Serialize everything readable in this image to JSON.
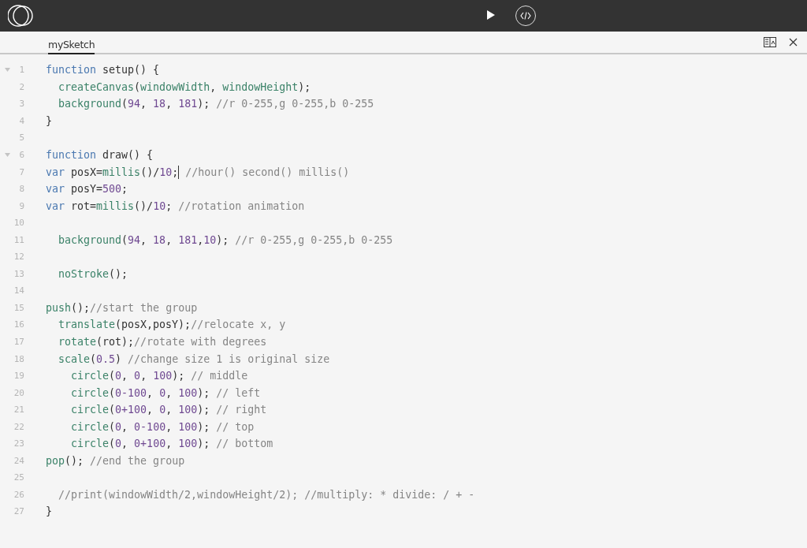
{
  "tabs": [
    {
      "label": "mySketch",
      "selected": true
    }
  ],
  "lines": [
    {
      "number": "1",
      "foldable": true,
      "tokens": [
        {
          "kind": "kw",
          "text": "function"
        },
        {
          "kind": "plain",
          "text": " setup() {"
        }
      ]
    },
    {
      "number": "2",
      "foldable": false,
      "kind": "inner",
      "tokens": [
        {
          "kind": "fn",
          "text": "createCanvas"
        },
        {
          "kind": "plain",
          "text": "("
        },
        {
          "kind": "fn",
          "text": "windowWidth"
        },
        {
          "kind": "plain",
          "text": ", "
        },
        {
          "kind": "fn",
          "text": "windowHeight"
        },
        {
          "kind": "plain",
          "text": ");"
        }
      ]
    },
    {
      "number": "3",
      "foldable": false,
      "kind": "inner",
      "tokens": [
        {
          "kind": "fn",
          "text": "background"
        },
        {
          "kind": "plain",
          "text": "("
        },
        {
          "kind": "num",
          "text": "94"
        },
        {
          "kind": "plain",
          "text": ", "
        },
        {
          "kind": "num",
          "text": "18"
        },
        {
          "kind": "plain",
          "text": ", "
        },
        {
          "kind": "num",
          "text": "181"
        },
        {
          "kind": "plain",
          "text": "); "
        },
        {
          "kind": "comment",
          "text": "//r 0-255,g 0-255,b 0-255"
        }
      ]
    },
    {
      "number": "4",
      "foldable": false,
      "tokens": [
        {
          "kind": "plain",
          "text": "}"
        }
      ]
    },
    {
      "number": "5",
      "foldable": false
    },
    {
      "number": "6",
      "foldable": true,
      "tokens": [
        {
          "kind": "kw",
          "text": "function"
        },
        {
          "kind": "plain",
          "text": " draw() {"
        }
      ]
    },
    {
      "number": "7",
      "foldable": false,
      "tokens": [
        {
          "kind": "kw",
          "text": "var"
        },
        {
          "kind": "plain",
          "text": " posX="
        },
        {
          "kind": "fn",
          "text": "millis"
        },
        {
          "kind": "plain",
          "text": "()/"
        },
        {
          "kind": "num",
          "text": "10"
        },
        {
          "kind": "plain",
          "text": ";"
        },
        {
          "kind": "cursor"
        },
        {
          "kind": "comment",
          "text": " //hour() second() millis()"
        }
      ]
    },
    {
      "number": "8",
      "foldable": false,
      "tokens": [
        {
          "kind": "kw",
          "text": "var"
        },
        {
          "kind": "plain",
          "text": " posY="
        },
        {
          "kind": "num",
          "text": "500"
        },
        {
          "kind": "plain",
          "text": ";"
        }
      ]
    },
    {
      "number": "9",
      "foldable": false,
      "tokens": [
        {
          "kind": "kw",
          "text": "var"
        },
        {
          "kind": "plain",
          "text": " rot="
        },
        {
          "kind": "fn",
          "text": "millis"
        },
        {
          "kind": "plain",
          "text": "()/"
        },
        {
          "kind": "num",
          "text": "10"
        },
        {
          "kind": "plain",
          "text": "; "
        },
        {
          "kind": "comment",
          "text": "//rotation animation"
        }
      ]
    },
    {
      "number": "10",
      "foldable": false
    },
    {
      "number": "11",
      "foldable": false,
      "kind": "inner",
      "tokens": [
        {
          "kind": "fn",
          "text": "background"
        },
        {
          "kind": "plain",
          "text": "("
        },
        {
          "kind": "num",
          "text": "94"
        },
        {
          "kind": "plain",
          "text": ", "
        },
        {
          "kind": "num",
          "text": "18"
        },
        {
          "kind": "plain",
          "text": ", "
        },
        {
          "kind": "num",
          "text": "181"
        },
        {
          "kind": "plain",
          "text": ","
        },
        {
          "kind": "num",
          "text": "10"
        },
        {
          "kind": "plain",
          "text": "); "
        },
        {
          "kind": "comment",
          "text": "//r 0-255,g 0-255,b 0-255"
        }
      ]
    },
    {
      "number": "12",
      "foldable": false
    },
    {
      "number": "13",
      "foldable": false,
      "kind": "inner",
      "tokens": [
        {
          "kind": "fn",
          "text": "noStroke"
        },
        {
          "kind": "plain",
          "text": "();"
        }
      ]
    },
    {
      "number": "14",
      "foldable": false
    },
    {
      "number": "15",
      "foldable": false,
      "tokens": [
        {
          "kind": "fn",
          "text": "push"
        },
        {
          "kind": "plain",
          "text": "();"
        },
        {
          "kind": "comment",
          "text": "//start the group"
        }
      ]
    },
    {
      "number": "16",
      "foldable": false,
      "kind": "inner",
      "tokens": [
        {
          "kind": "fn",
          "text": "translate"
        },
        {
          "kind": "plain",
          "text": "(posX,posY);"
        },
        {
          "kind": "comment",
          "text": "//relocate x, y"
        }
      ]
    },
    {
      "number": "17",
      "foldable": false,
      "kind": "inner",
      "tokens": [
        {
          "kind": "fn",
          "text": "rotate"
        },
        {
          "kind": "plain",
          "text": "(rot);"
        },
        {
          "kind": "comment",
          "text": "//rotate with degrees"
        }
      ]
    },
    {
      "number": "18",
      "foldable": false,
      "kind": "inner",
      "tokens": [
        {
          "kind": "fn",
          "text": "scale"
        },
        {
          "kind": "plain",
          "text": "("
        },
        {
          "kind": "num",
          "text": "0.5"
        },
        {
          "kind": "plain",
          "text": ") "
        },
        {
          "kind": "comment",
          "text": "//change size 1 is original size"
        }
      ]
    },
    {
      "number": "19",
      "foldable": false,
      "kind": "nested",
      "tokens": [
        {
          "kind": "fn",
          "text": "circle"
        },
        {
          "kind": "plain",
          "text": "("
        },
        {
          "kind": "num",
          "text": "0"
        },
        {
          "kind": "plain",
          "text": ", "
        },
        {
          "kind": "num",
          "text": "0"
        },
        {
          "kind": "plain",
          "text": ", "
        },
        {
          "kind": "num",
          "text": "100"
        },
        {
          "kind": "plain",
          "text": "); "
        },
        {
          "kind": "comment",
          "text": "// middle"
        }
      ]
    },
    {
      "number": "20",
      "foldable": false,
      "kind": "nested",
      "tokens": [
        {
          "kind": "fn",
          "text": "circle"
        },
        {
          "kind": "plain",
          "text": "("
        },
        {
          "kind": "num",
          "text": "0-100"
        },
        {
          "kind": "plain",
          "text": ", "
        },
        {
          "kind": "num",
          "text": "0"
        },
        {
          "kind": "plain",
          "text": ", "
        },
        {
          "kind": "num",
          "text": "100"
        },
        {
          "kind": "plain",
          "text": "); "
        },
        {
          "kind": "comment",
          "text": "// left"
        }
      ]
    },
    {
      "number": "21",
      "foldable": false,
      "kind": "nested",
      "tokens": [
        {
          "kind": "fn",
          "text": "circle"
        },
        {
          "kind": "plain",
          "text": "("
        },
        {
          "kind": "num",
          "text": "0+100"
        },
        {
          "kind": "plain",
          "text": ", "
        },
        {
          "kind": "num",
          "text": "0"
        },
        {
          "kind": "plain",
          "text": ", "
        },
        {
          "kind": "num",
          "text": "100"
        },
        {
          "kind": "plain",
          "text": "); "
        },
        {
          "kind": "comment",
          "text": "// right"
        }
      ]
    },
    {
      "number": "22",
      "foldable": false,
      "kind": "nested",
      "tokens": [
        {
          "kind": "fn",
          "text": "circle"
        },
        {
          "kind": "plain",
          "text": "("
        },
        {
          "kind": "num",
          "text": "0"
        },
        {
          "kind": "plain",
          "text": ", "
        },
        {
          "kind": "num",
          "text": "0-100"
        },
        {
          "kind": "plain",
          "text": ", "
        },
        {
          "kind": "num",
          "text": "100"
        },
        {
          "kind": "plain",
          "text": "); "
        },
        {
          "kind": "comment",
          "text": "// top"
        }
      ]
    },
    {
      "number": "23",
      "foldable": false,
      "kind": "nested",
      "tokens": [
        {
          "kind": "fn",
          "text": "circle"
        },
        {
          "kind": "plain",
          "text": "("
        },
        {
          "kind": "num",
          "text": "0"
        },
        {
          "kind": "plain",
          "text": ", "
        },
        {
          "kind": "num",
          "text": "0+100"
        },
        {
          "kind": "plain",
          "text": ", "
        },
        {
          "kind": "num",
          "text": "100"
        },
        {
          "kind": "plain",
          "text": "); "
        },
        {
          "kind": "comment",
          "text": "// bottom"
        }
      ]
    },
    {
      "number": "24",
      "foldable": false,
      "tokens": [
        {
          "kind": "fn",
          "text": "pop"
        },
        {
          "kind": "plain",
          "text": "(); "
        },
        {
          "kind": "comment",
          "text": "//end the group"
        }
      ]
    },
    {
      "number": "25",
      "foldable": false
    },
    {
      "number": "26",
      "foldable": false,
      "kind": "inner",
      "tokens": [
        {
          "kind": "comment",
          "text": "//print(windowWidth/2,windowHeight/2); //multiply: * divide: / + -"
        }
      ]
    },
    {
      "number": "27",
      "foldable": false,
      "tokens": [
        {
          "kind": "plain",
          "text": "}"
        }
      ]
    }
  ]
}
